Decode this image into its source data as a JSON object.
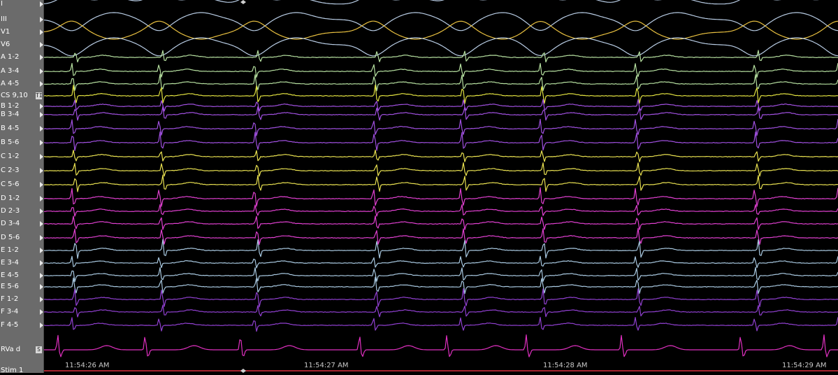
{
  "channels": [
    {
      "label": "I",
      "color": "#b8cce4"
    },
    {
      "label": "III",
      "color": "#b8cce4"
    },
    {
      "label": "V1",
      "color": "#e8c040"
    },
    {
      "label": "V6",
      "color": "#b8cce4"
    },
    {
      "label": "A 1-2",
      "color": "#b6e0a0"
    },
    {
      "label": "A 3-4",
      "color": "#b6e0a0"
    },
    {
      "label": "A 4-5",
      "color": "#b6e0a0"
    },
    {
      "label": "CS 9,10",
      "color": "#e0e040",
      "badge": "TI"
    },
    {
      "label": "B 1-2",
      "color": "#a050e0"
    },
    {
      "label": "B 3-4",
      "color": "#a050e0"
    },
    {
      "label": "B 4-5",
      "color": "#a050e0"
    },
    {
      "label": "B 5-6",
      "color": "#a050e0"
    },
    {
      "label": "C 1-2",
      "color": "#e8e050"
    },
    {
      "label": "C 2-3",
      "color": "#e8e050"
    },
    {
      "label": "C 5-6",
      "color": "#e8e050"
    },
    {
      "label": "D 1-2",
      "color": "#e040d0"
    },
    {
      "label": "D 2-3",
      "color": "#e040d0"
    },
    {
      "label": "D 3-4",
      "color": "#e040d0"
    },
    {
      "label": "D 5-6",
      "color": "#e040d0"
    },
    {
      "label": "E 1-2",
      "color": "#a8c8e0"
    },
    {
      "label": "E 3-4",
      "color": "#a8c8e0"
    },
    {
      "label": "E 4-5",
      "color": "#a8c8e0"
    },
    {
      "label": "E 5-6",
      "color": "#a8c8e0"
    },
    {
      "label": "F 1-2",
      "color": "#9040d0"
    },
    {
      "label": "F 3-4",
      "color": "#9040d0"
    },
    {
      "label": "F 4-5",
      "color": "#9040d0"
    },
    {
      "label": "RVa d",
      "color": "#e030c0",
      "badge": "S"
    },
    {
      "label": "Stim 1",
      "color": "#e03040"
    }
  ],
  "time_labels": [
    "11:54:26 AM",
    "11:54:27 AM",
    "11:54:28 AM",
    "11:54:29 AM"
  ],
  "beat_times": [
    0.035,
    0.145,
    0.265,
    0.415,
    0.525,
    0.625,
    0.745,
    0.895,
    1.0,
    1.105
  ]
}
